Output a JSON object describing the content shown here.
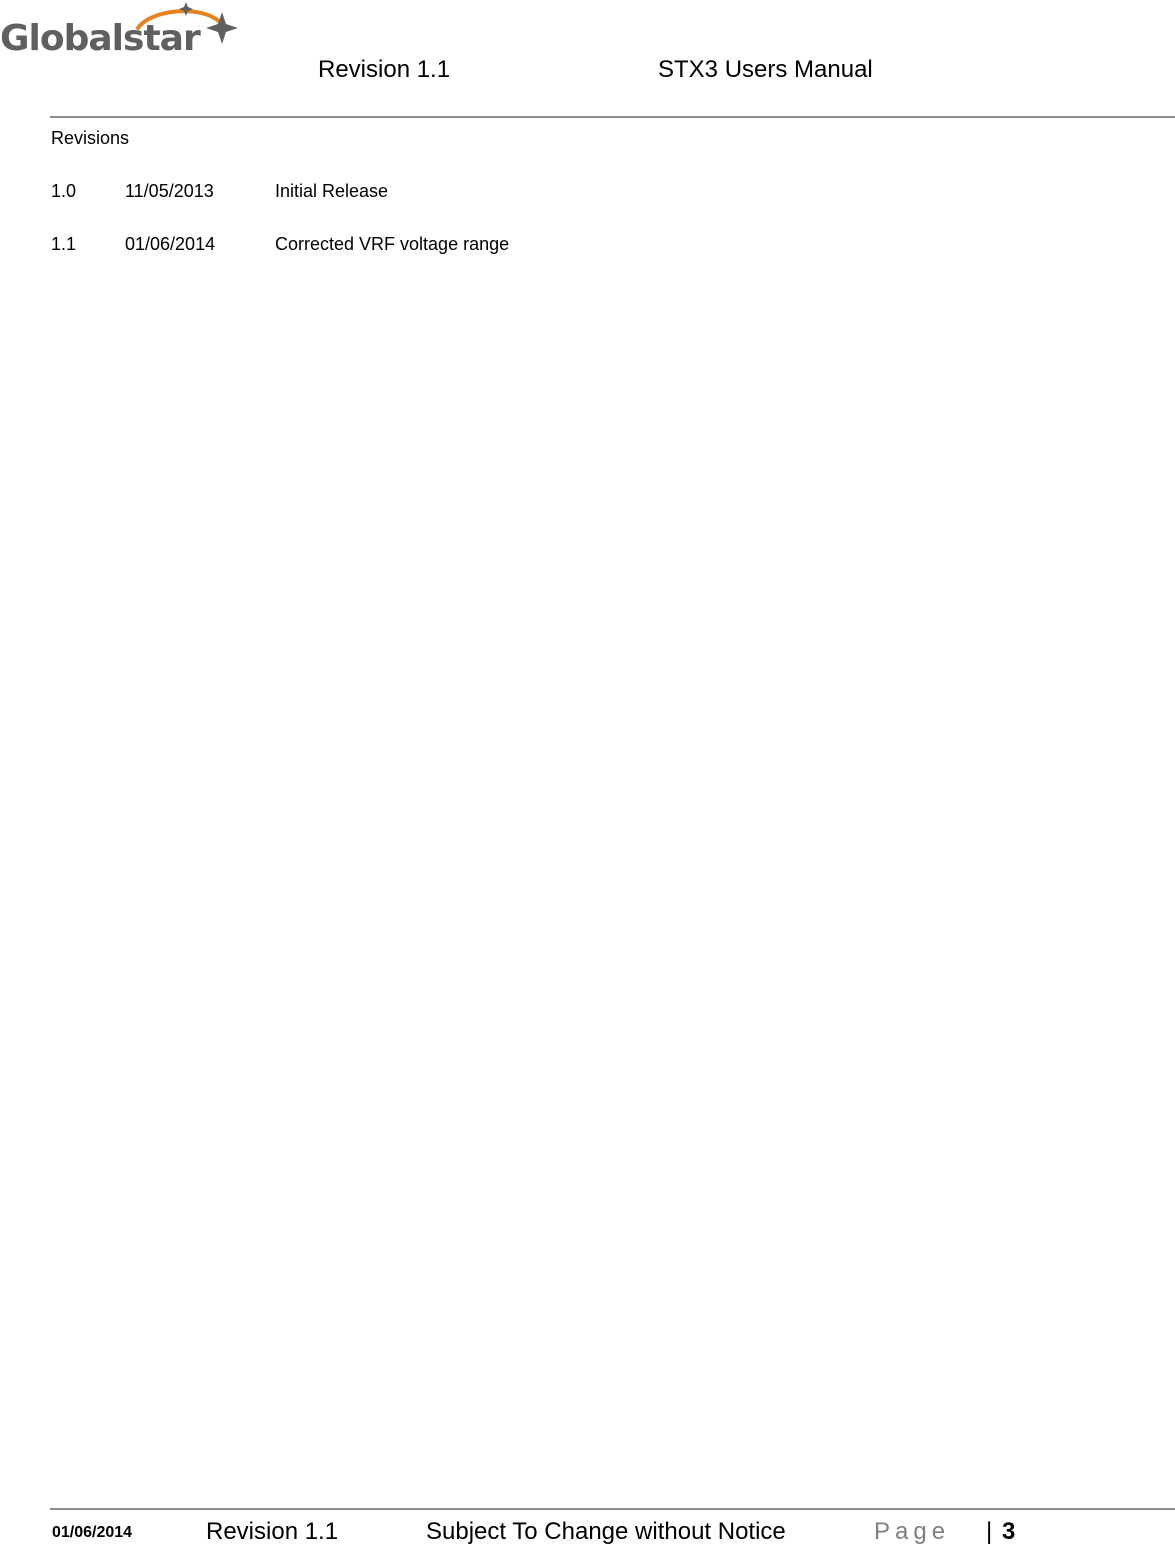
{
  "header": {
    "logo_text": "Globalstar",
    "revision": "Revision 1.1",
    "title": "STX3 Users Manual"
  },
  "colors": {
    "logo_gray": "#5f6062",
    "logo_orange": "#e8821e",
    "rule_gray": "#8c8c8c",
    "page_label_gray": "#7f7f7f"
  },
  "body": {
    "section_title": "Revisions",
    "revisions": [
      {
        "version": "1.0",
        "date": "11/05/2013",
        "description": "Initial Release"
      },
      {
        "version": "1.1",
        "date": "01/06/2014",
        "description": "Corrected VRF voltage range"
      }
    ]
  },
  "footer": {
    "date": "01/06/2014",
    "revision": "Revision 1.1",
    "notice": "Subject To Change without Notice",
    "page_label": "Page",
    "separator": "|",
    "page_number": "3"
  }
}
